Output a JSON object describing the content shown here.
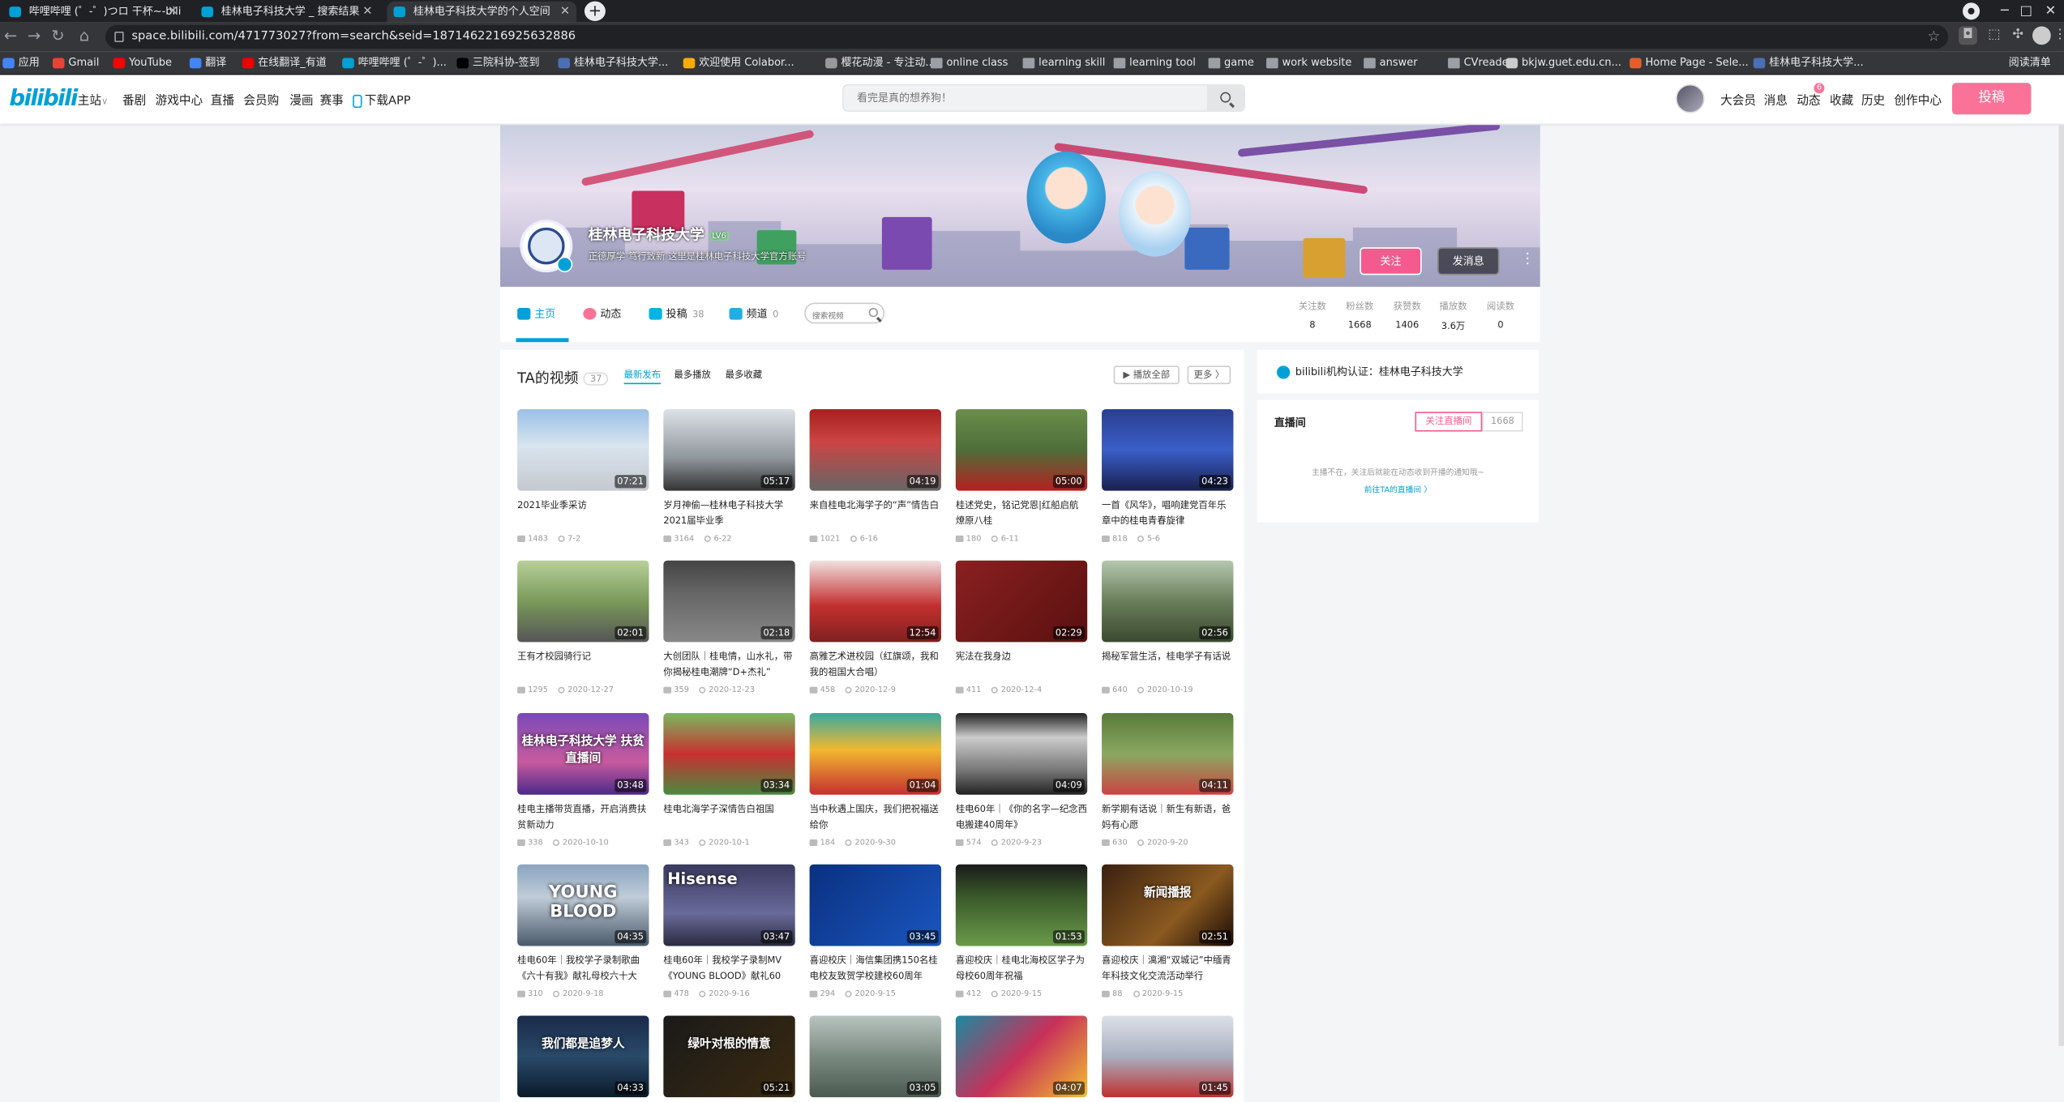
{
  "browser": {
    "tabs": [
      {
        "title": "哔哩哔哩 (゜-゜)つロ 干杯~-bili",
        "active": false
      },
      {
        "title": "桂林电子科技大学 _ 搜索结果",
        "active": false
      },
      {
        "title": "桂林电子科技大学的个人空间",
        "active": true
      }
    ],
    "url": "space.bilibili.com/471773027?from=search&seid=1871462216925632886",
    "bookmarks": [
      {
        "label": "应用",
        "icon": "apps-icon",
        "color": "#4285f4"
      },
      {
        "label": "Gmail",
        "icon": "gmail-icon",
        "color": "#ea4335"
      },
      {
        "label": "YouTube",
        "icon": "youtube-icon",
        "color": "#ff0000"
      },
      {
        "label": "翻译",
        "icon": "translate-icon",
        "color": "#4285f4"
      },
      {
        "label": "在线翻译_有道",
        "icon": "youdao-icon",
        "color": "#e00"
      },
      {
        "label": "哔哩哔哩 (゜-゜)...",
        "icon": "bilibili-icon",
        "color": "#00a1d6"
      },
      {
        "label": "三院科协-签到",
        "icon": "bookmark-icon",
        "color": "#000"
      },
      {
        "label": "桂林电子科技大学...",
        "icon": "bookmark-icon",
        "color": "#4a6fb5"
      },
      {
        "label": "欢迎使用 Colabor...",
        "icon": "colab-icon",
        "color": "#f9ab00"
      },
      {
        "label": "樱花动漫 - 专注动...",
        "icon": "bookmark-icon",
        "color": "#999"
      },
      {
        "label": "online class",
        "icon": "folder-icon",
        "color": "folder"
      },
      {
        "label": "learning skill",
        "icon": "folder-icon",
        "color": "folder"
      },
      {
        "label": "learning tool",
        "icon": "folder-icon",
        "color": "folder"
      },
      {
        "label": "game",
        "icon": "folder-icon",
        "color": "folder"
      },
      {
        "label": "work website",
        "icon": "folder-icon",
        "color": "folder"
      },
      {
        "label": "answer",
        "icon": "folder-icon",
        "color": "folder"
      },
      {
        "label": "CVreader",
        "icon": "folder-icon",
        "color": "folder"
      },
      {
        "label": "bkjw.guet.edu.cn...",
        "icon": "globe-icon",
        "color": "#ccc"
      },
      {
        "label": "Home Page - Sele...",
        "icon": "bookmark-icon",
        "color": "#e35e2a"
      },
      {
        "label": "桂林电子科技大学...",
        "icon": "bookmark-icon",
        "color": "#4a6fb5"
      }
    ],
    "reading_list": "阅读清单"
  },
  "header": {
    "logo": "bilibili",
    "nav": [
      "主站",
      "番剧",
      "游戏中心",
      "直播",
      "会员购",
      "漫画",
      "赛事",
      "下载APP"
    ],
    "search_placeholder": "看完是真的想养狗！",
    "right_nav": [
      "大会员",
      "消息",
      "动态",
      "收藏",
      "历史",
      "创作中心"
    ],
    "dynamic_badge": "6",
    "upload_label": "投稿"
  },
  "banner": {
    "name": "桂林电子科技大学",
    "level": "LV6",
    "sign": "正德厚学 笃行致新 这里是桂林电子科技大学官方账号",
    "follow_label": "关注",
    "message_label": "发消息",
    "more_label": "⋮"
  },
  "profile_tabs": [
    {
      "label": "主页",
      "count": "",
      "active": true,
      "icon": "home-icon",
      "color": "#00a1d6"
    },
    {
      "label": "动态",
      "count": "",
      "active": false,
      "icon": "dynamic-icon",
      "color": "#fb7299"
    },
    {
      "label": "投稿",
      "count": "38",
      "active": false,
      "icon": "upload-icon",
      "color": "#00b5e5"
    },
    {
      "label": "频道",
      "count": "0",
      "active": false,
      "icon": "channel-icon",
      "color": "#23ade5"
    }
  ],
  "video_search_placeholder": "搜索视频",
  "stats": [
    {
      "label": "关注数",
      "value": "8"
    },
    {
      "label": "粉丝数",
      "value": "1668"
    },
    {
      "label": "获赞数",
      "value": "1406"
    },
    {
      "label": "播放数",
      "value": "3.6万"
    },
    {
      "label": "阅读数",
      "value": "0"
    }
  ],
  "videos_section": {
    "title": "TA的视频",
    "count": "37",
    "sort": [
      "最新发布",
      "最多播放",
      "最多收藏"
    ],
    "play_all": "▶ 播放全部",
    "more": "更多 〉"
  },
  "videos": [
    {
      "title": "2021毕业季采访",
      "duration": "07:21",
      "plays": "1483",
      "date": "7-2",
      "bg": "linear-gradient(180deg,#9ac0e8,#d8e4ee 45%,#c5c9cf)"
    },
    {
      "title": "岁月神偷—桂林电子科技大学2021届毕业季",
      "duration": "05:17",
      "plays": "3164",
      "date": "6-22",
      "bg": "linear-gradient(180deg,#dde2e6,#8f969c 60%,#333)"
    },
    {
      "title": "来自桂电北海学子的“声”情告白",
      "duration": "04:19",
      "plays": "1021",
      "date": "6-16",
      "bg": "linear-gradient(180deg,#a72020,#c44 40%,#666)"
    },
    {
      "title": "桂述党史，铭记党恩|红船启航 燎原八桂",
      "duration": "05:00",
      "plays": "180",
      "date": "6-11",
      "bg": "linear-gradient(180deg,#6a8e4a,#4e6e3a 50%,#b52020)"
    },
    {
      "title": "一首《风华》，唱响建党百年乐章中的桂电青春旋律",
      "duration": "04:23",
      "plays": "818",
      "date": "5-6",
      "bg": "linear-gradient(180deg,#2a3f8f,#3a5ec8 50%,#1a2050)"
    },
    {
      "title": "王有才校园骑行记",
      "duration": "02:01",
      "plays": "1295",
      "date": "2020-12-27",
      "bg": "linear-gradient(180deg,#b8d09a,#7a9a5a 50%,#555)"
    },
    {
      "title": "大创团队｜桂电情，山水礼，带你揭秘桂电潮牌“D+杰礼”",
      "duration": "02:18",
      "plays": "359",
      "date": "2020-12-23",
      "bg": "linear-gradient(180deg,#444,#666 40%,#888)"
    },
    {
      "title": "高雅艺术进校园（红旗颂，我和我的祖国大合唱）",
      "duration": "12:54",
      "plays": "458",
      "date": "2020-12-9",
      "bg": "linear-gradient(180deg,#f0e0e0,#c43030 55%,#802020)"
    },
    {
      "title": "宪法在我身边",
      "duration": "02:29",
      "plays": "411",
      "date": "2020-12-4",
      "bg": "linear-gradient(135deg,#8a2020,#5a1010)"
    },
    {
      "title": "揭秘军营生活，桂电学子有话说",
      "duration": "02:56",
      "plays": "640",
      "date": "2020-10-19",
      "bg": "linear-gradient(180deg,#b5c8b0,#6a7e5a 50%,#3a4a30)"
    },
    {
      "title": "桂电主播带货直播，开启消费扶贫新动力",
      "duration": "03:48",
      "plays": "338",
      "date": "2020-10-10",
      "bg": "linear-gradient(180deg,#7a4ab8,#c85a9e 60%,#4a2a8a)"
    },
    {
      "title": "桂电北海学子深情告白祖国",
      "duration": "03:34",
      "plays": "343",
      "date": "2020-10-1",
      "bg": "linear-gradient(180deg,#7ab860,#c83030 50%,#4a8a40)"
    },
    {
      "title": "当中秋遇上国庆，我们把祝福送给你",
      "duration": "01:04",
      "plays": "184",
      "date": "2020-9-30",
      "bg": "linear-gradient(180deg,#3aa8a0,#f2b830 45%,#c43030)"
    },
    {
      "title": "桂电60年｜《你的名字—纪念西电搬建40周年》",
      "duration": "04:09",
      "plays": "574",
      "date": "2020-9-23",
      "bg": "linear-gradient(180deg,#222,#ccc 30%,#777 70%,#222)"
    },
    {
      "title": "新学期有话说｜新生有新语，爸妈有心愿",
      "duration": "04:11",
      "plays": "630",
      "date": "2020-9-20",
      "bg": "linear-gradient(180deg,#5a7a3a,#8aa860 50%,#c44)"
    },
    {
      "title": "桂电60年｜我校学子录制歌曲《六十有我》献礼母校六十大",
      "duration": "04:35",
      "plays": "310",
      "date": "2020-9-18",
      "bg": "linear-gradient(180deg,#8aa4c0,#c0ccd8 40%,#4a5a6a)"
    },
    {
      "title": "桂电60年｜我校学子录制MV《YOUNG BLOOD》献礼60",
      "duration": "03:47",
      "plays": "478",
      "date": "2020-9-16",
      "bg": "linear-gradient(180deg,#3a3a60,#6a6a9a 60%,#2a2a40)"
    },
    {
      "title": "喜迎校庆｜海信集团携150名桂电校友致贺学校建校60周年",
      "duration": "03:45",
      "plays": "294",
      "date": "2020-9-15",
      "bg": "linear-gradient(135deg,#0a3080,#1a56c0)"
    },
    {
      "title": "喜迎校庆｜桂电北海校区学子为母校60周年祝福",
      "duration": "01:53",
      "plays": "412",
      "date": "2020-9-15",
      "bg": "linear-gradient(180deg,#1a1a1a,#3a5a2a 40%,#6a9a4a)"
    },
    {
      "title": "喜迎校庆｜漓湘“双城记”中缅青年科技文化交流活动举行",
      "duration": "02:51",
      "plays": "88",
      "date": "2020-9-15",
      "bg": "linear-gradient(135deg,#3a2010,#8a5a20 60%,#1a0a05)"
    },
    {
      "title": "",
      "duration": "04:33",
      "plays": "",
      "date": "",
      "bg": "linear-gradient(180deg,#1a2a4a,#2a4a6a 50%,#0a1a2a)"
    },
    {
      "title": "",
      "duration": "05:21",
      "plays": "",
      "date": "",
      "bg": "linear-gradient(135deg,#1a1a1a,#3a2a10)"
    },
    {
      "title": "",
      "duration": "03:05",
      "plays": "",
      "date": "",
      "bg": "linear-gradient(180deg,#b8c4c0,#7a8a80 50%,#4a5a50)"
    },
    {
      "title": "",
      "duration": "04:07",
      "plays": "",
      "date": "",
      "bg": "linear-gradient(135deg,#1a8aa0,#c8305a 50%,#f2c030)"
    },
    {
      "title": "",
      "duration": "01:45",
      "plays": "",
      "date": "",
      "bg": "linear-gradient(180deg,#dde0e8,#a8b0c0 50%,#c03030)"
    }
  ],
  "thumb_texts": {
    "v10": "桂林电子科技大学 扶贫直播间",
    "v15": "YOUNG BLOOD",
    "v16": "Hisense",
    "v19": "新闻播报",
    "v20": "我们都是追梦人",
    "v21": "绿叶对根的情意"
  },
  "certification": "bilibili机构认证：桂林电子科技大学",
  "live_room": {
    "title": "直播间",
    "follow": "关注直播间",
    "follow_count": "1668",
    "desc": "主播不在，关注后就能在动态收到开播的通知哦~",
    "link": "前往TA的直播间 〉"
  }
}
